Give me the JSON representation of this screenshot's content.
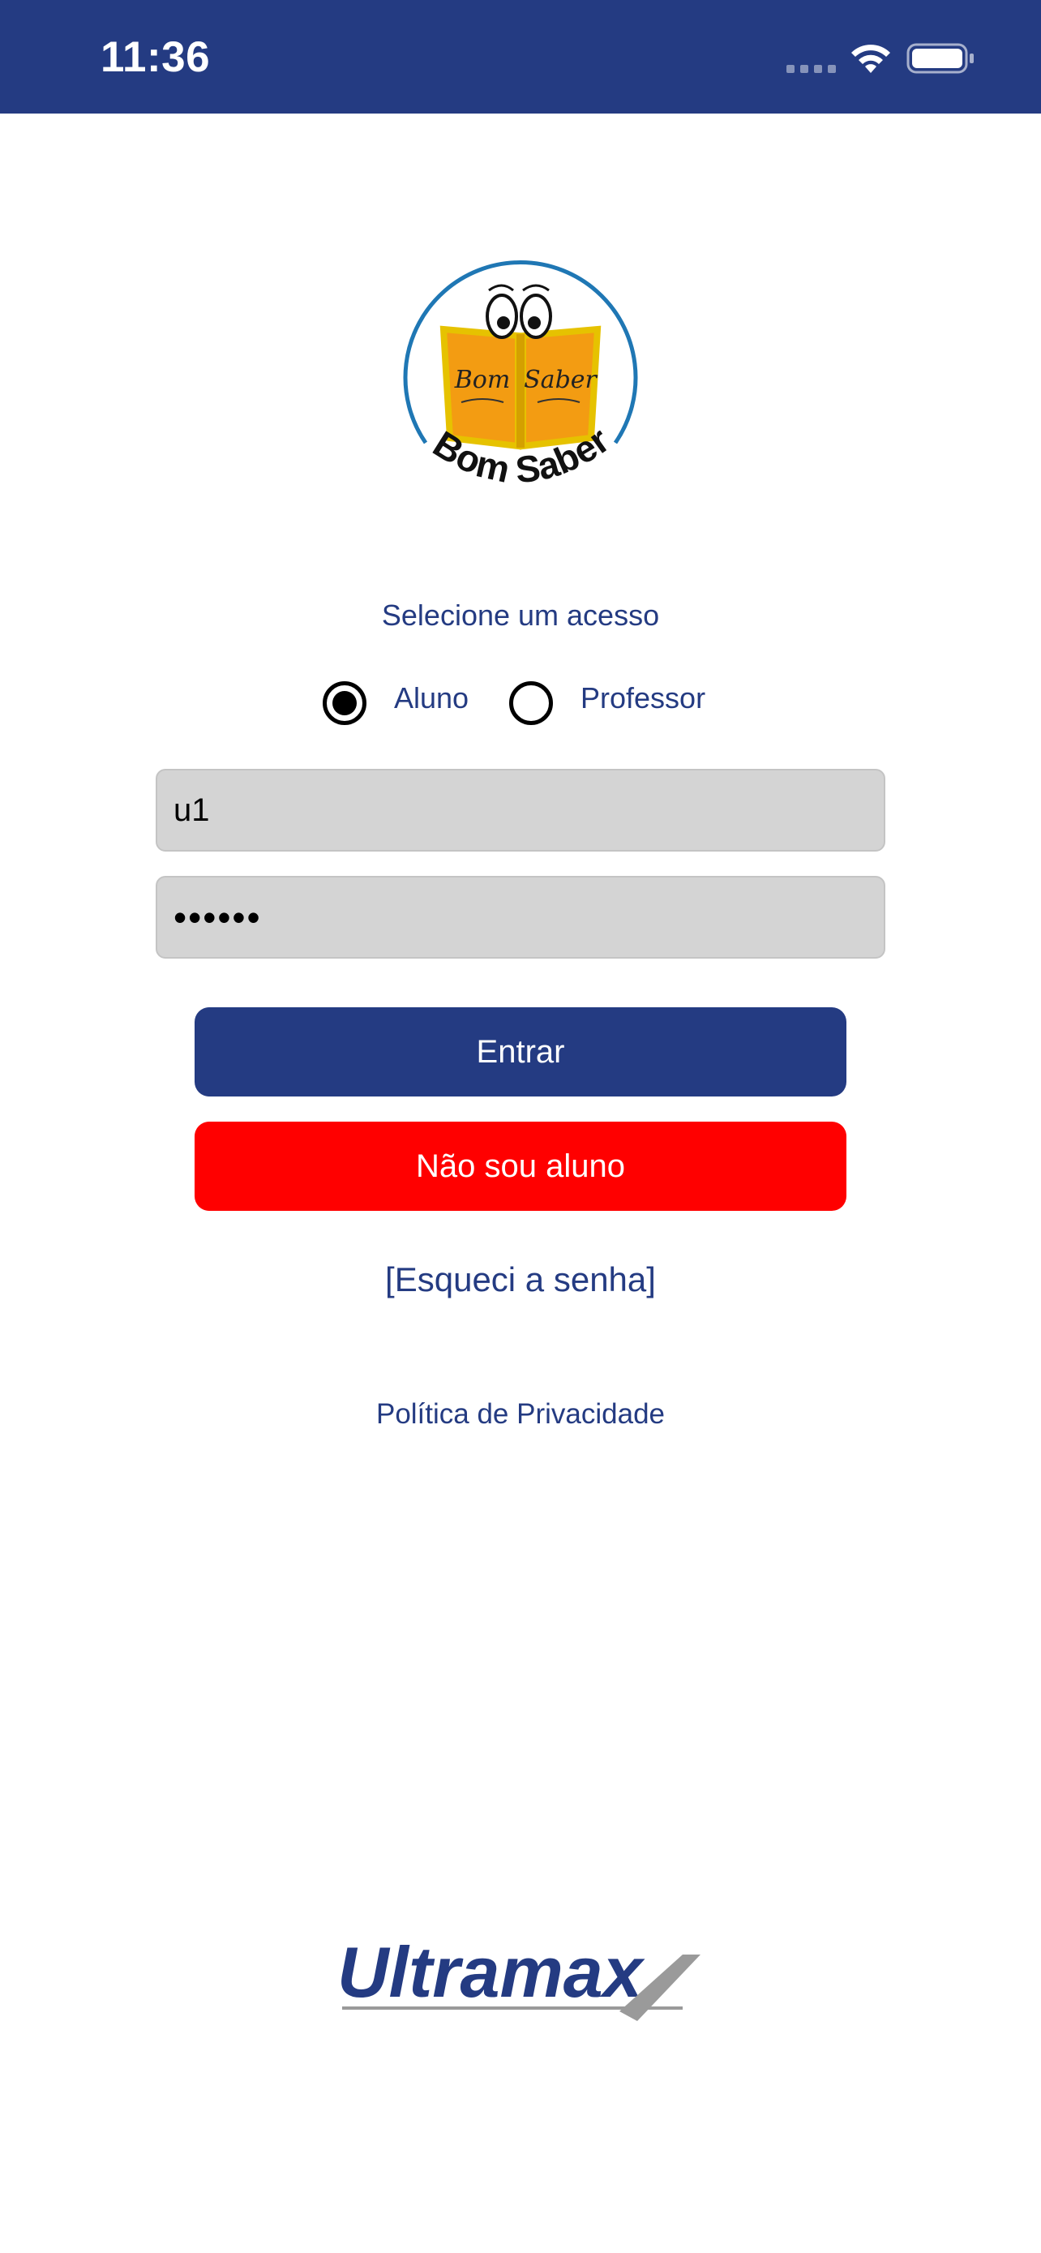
{
  "status_bar": {
    "time": "11:36",
    "background": "#243b82"
  },
  "logo": {
    "name": "bom-saber-logo",
    "text": "Bom Saber",
    "book_left": "Bom",
    "book_right": "Saber"
  },
  "login": {
    "select_label": "Selecione um acesso",
    "options": [
      {
        "label": "Aluno",
        "selected": true
      },
      {
        "label": "Professor",
        "selected": false
      }
    ],
    "username_value": "u1",
    "password_value": "••••••",
    "enter_label": "Entrar",
    "not_student_label": "Não sou aluno",
    "forgot_label": "[Esqueci a senha]",
    "privacy_label": "Política de Privacidade"
  },
  "footer": {
    "brand": "Ultramax"
  },
  "colors": {
    "primary": "#243b82",
    "danger": "#ff0000",
    "input_bg": "#d4d4d4"
  }
}
